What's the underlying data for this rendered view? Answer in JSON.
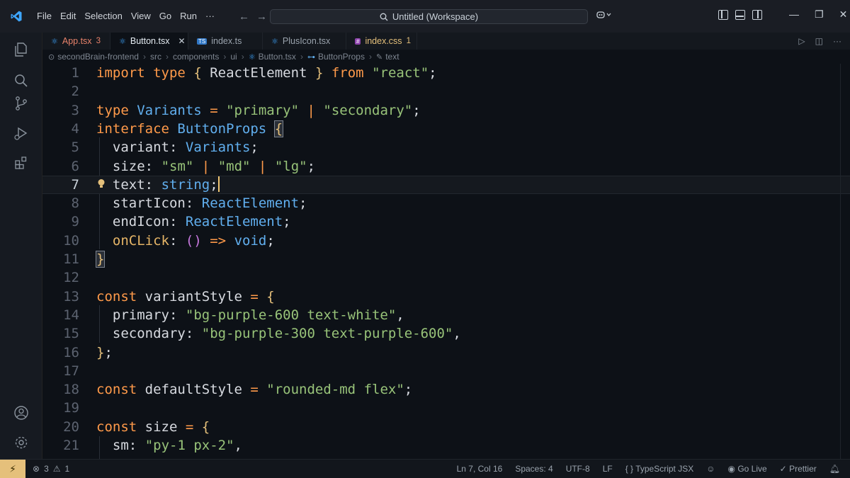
{
  "titlebar": {
    "menu": [
      "File",
      "Edit",
      "Selection",
      "View",
      "Go",
      "Run",
      "···"
    ],
    "search_text": "Untitled (Workspace)"
  },
  "tabs": [
    {
      "label": "App.tsx",
      "badge": "3",
      "icon": "react-icon",
      "color": "#e8826a",
      "active": false
    },
    {
      "label": "Button.tsx",
      "badge": "",
      "icon": "react-icon",
      "color": "#e6edf3",
      "active": true
    },
    {
      "label": "index.ts",
      "badge": "",
      "icon": "ts-icon",
      "color": "#9aa3ad",
      "active": false
    },
    {
      "label": "PlusIcon.tsx",
      "badge": "",
      "icon": "react-icon",
      "color": "#9aa3ad",
      "active": false
    },
    {
      "label": "index.css",
      "badge": "1",
      "icon": "css-icon",
      "color": "#e5c07b",
      "active": false
    }
  ],
  "breadcrumb": [
    "secondBrain-frontend",
    "src",
    "components",
    "ui",
    "Button.tsx",
    "ButtonProps",
    "text"
  ],
  "editor": {
    "current_line": 7,
    "line_numbers": [
      "1",
      "2",
      "3",
      "4",
      "5",
      "6",
      "7",
      "8",
      "9",
      "10",
      "11",
      "12",
      "13",
      "14",
      "15",
      "16",
      "17",
      "18",
      "19",
      "20",
      "21"
    ]
  },
  "statusbar": {
    "problems_errors": "3",
    "problems_warnings": "1",
    "position": "Ln 7, Col 16",
    "spaces": "Spaces: 4",
    "encoding": "UTF-8",
    "eol": "LF",
    "language": "TypeScript JSX",
    "golive": "Go Live",
    "prettier": "Prettier"
  },
  "colors": {
    "keyword": "#ff9a4a",
    "type": "#61afef",
    "string": "#98c379",
    "accent": "#e5c07b"
  }
}
